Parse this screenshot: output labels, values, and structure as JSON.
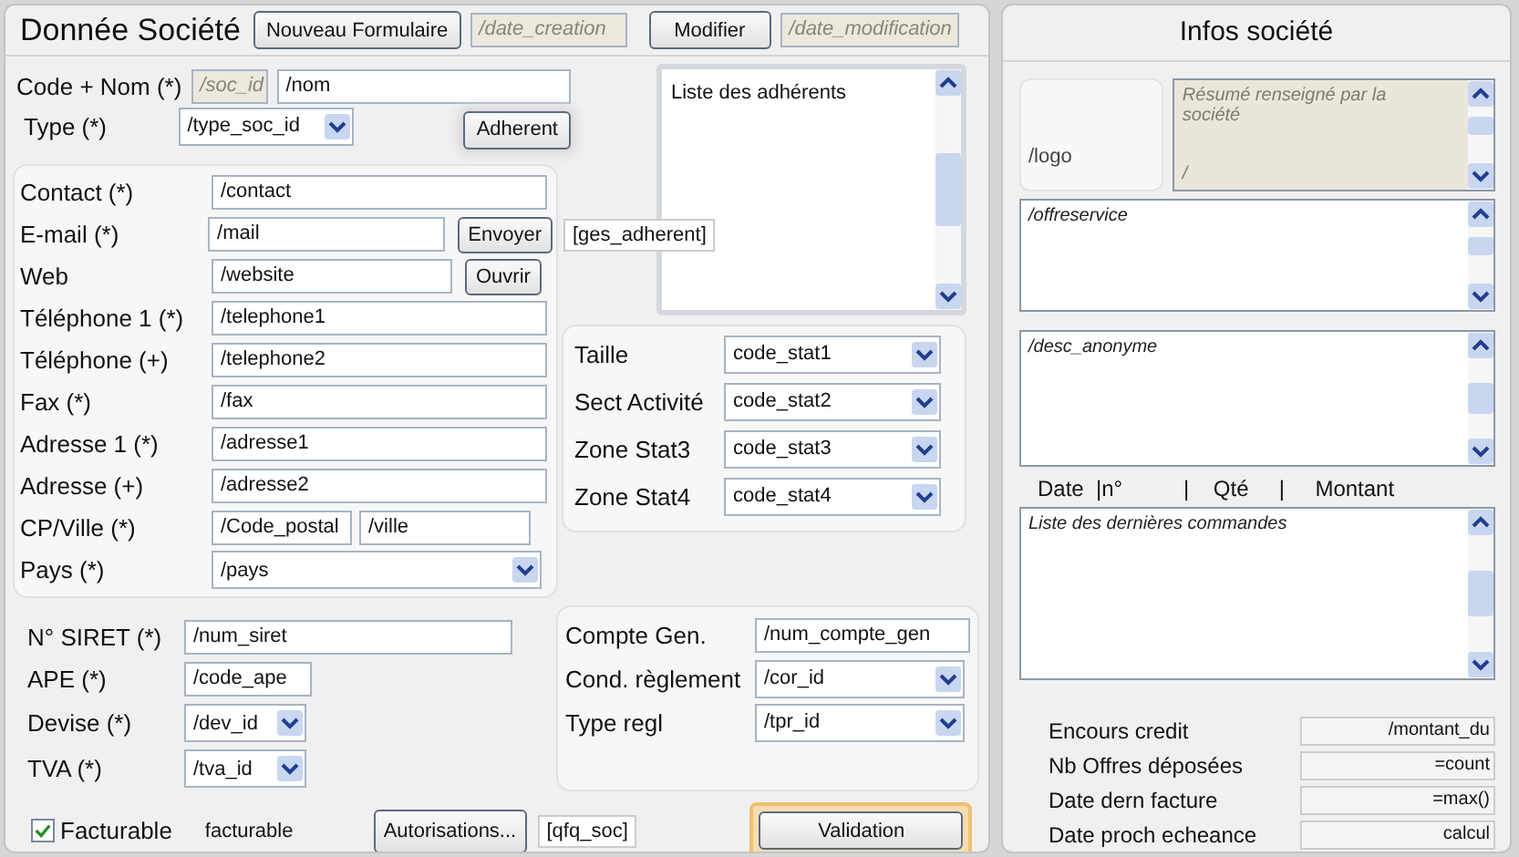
{
  "header": {
    "title": "Donnée Société",
    "new_button": "Nouveau Formulaire",
    "date_creation": {
      "value": "/date_creation",
      "disabled": true
    },
    "modify_button": "Modifier",
    "date_modification": {
      "value": "/date_modification",
      "disabled": true
    }
  },
  "identity": {
    "label": "Code + Nom (*)",
    "code_field": {
      "value": "/soc_id",
      "disabled": true
    },
    "name_field": {
      "value": "/nom",
      "disabled": false
    },
    "type_label": "Type (*)",
    "type_select": "/type_soc_id",
    "adherent_button": "Adherent"
  },
  "adherents": {
    "list_text": "Liste des adhérents",
    "tag": "[ges_adherent]"
  },
  "contact_rows": [
    {
      "kind": "text",
      "label": "Contact (*)",
      "fields": [
        "/contact"
      ]
    },
    {
      "kind": "text",
      "label": "E-mail (*)",
      "fields": [
        "/mail"
      ],
      "button": "Envoyer"
    },
    {
      "kind": "text",
      "label": "Web",
      "fields": [
        "/website"
      ],
      "button": "Ouvrir"
    },
    {
      "kind": "text",
      "label": "Téléphone 1 (*)",
      "fields": [
        "/telephone1"
      ]
    },
    {
      "kind": "text",
      "label": "Téléphone (+)",
      "fields": [
        "/telephone2"
      ]
    },
    {
      "kind": "text",
      "label": "Fax (*)",
      "fields": [
        "/fax"
      ]
    },
    {
      "kind": "text",
      "label": "Adresse 1 (*)",
      "fields": [
        "/adresse1"
      ]
    },
    {
      "kind": "text",
      "label": "Adresse (+)",
      "fields": [
        "/adresse2"
      ]
    },
    {
      "kind": "text",
      "label": "CP/Ville (*)",
      "fields": [
        "/Code_postal",
        "/ville"
      ]
    },
    {
      "kind": "select",
      "label": "Pays (*)",
      "fields": [
        "/pays"
      ]
    }
  ],
  "stats": [
    {
      "label": "Taille",
      "value": "code_stat1"
    },
    {
      "label": "Sect Activité",
      "value": "code_stat2"
    },
    {
      "label": "Zone Stat3",
      "value": "code_stat3"
    },
    {
      "label": "Zone Stat4",
      "value": "code_stat4"
    }
  ],
  "legal_rows": [
    {
      "kind": "text",
      "label": "N° SIRET (*)",
      "value": "/num_siret"
    },
    {
      "kind": "text",
      "label": "APE (*)",
      "value": "/code_ape"
    },
    {
      "kind": "select",
      "label": "Devise (*)",
      "value": "/dev_id"
    },
    {
      "kind": "select",
      "label": "TVA (*)",
      "value": "/tva_id"
    }
  ],
  "accounting_rows": [
    {
      "kind": "text",
      "label": "Compte Gen.",
      "value": "/num_compte_gen"
    },
    {
      "kind": "select",
      "label": "Cond. règlement",
      "value": "/cor_id"
    },
    {
      "kind": "select",
      "label": "Type regl",
      "value": "/tpr_id"
    }
  ],
  "footer": {
    "facturable": {
      "label": "Facturable",
      "checked": true
    },
    "facturable_text": "facturable",
    "auth_button": "Autorisations...",
    "auth_tag": "[qfq_soc]",
    "validate_button": {
      "label": "Validation",
      "focused": true
    }
  },
  "infos": {
    "title": "Infos société",
    "logo": "/logo",
    "summary": {
      "hint": "Résumé renseigné par la société",
      "value": "/"
    },
    "offer_text": "/offreservice",
    "description_text": "/desc_anonyme",
    "orders_header": "Date  |n°          |    Qté     |     Montant",
    "orders_text": "Liste des dernières commandes",
    "summary_rows": [
      {
        "label": "Encours credit",
        "value": "/montant_du"
      },
      {
        "label": "Nb Offres déposées",
        "value": "=count"
      },
      {
        "label": "Date dern facture",
        "value": "=max()"
      },
      {
        "label": "Date proch echeance",
        "value": "calcul"
      }
    ]
  }
}
